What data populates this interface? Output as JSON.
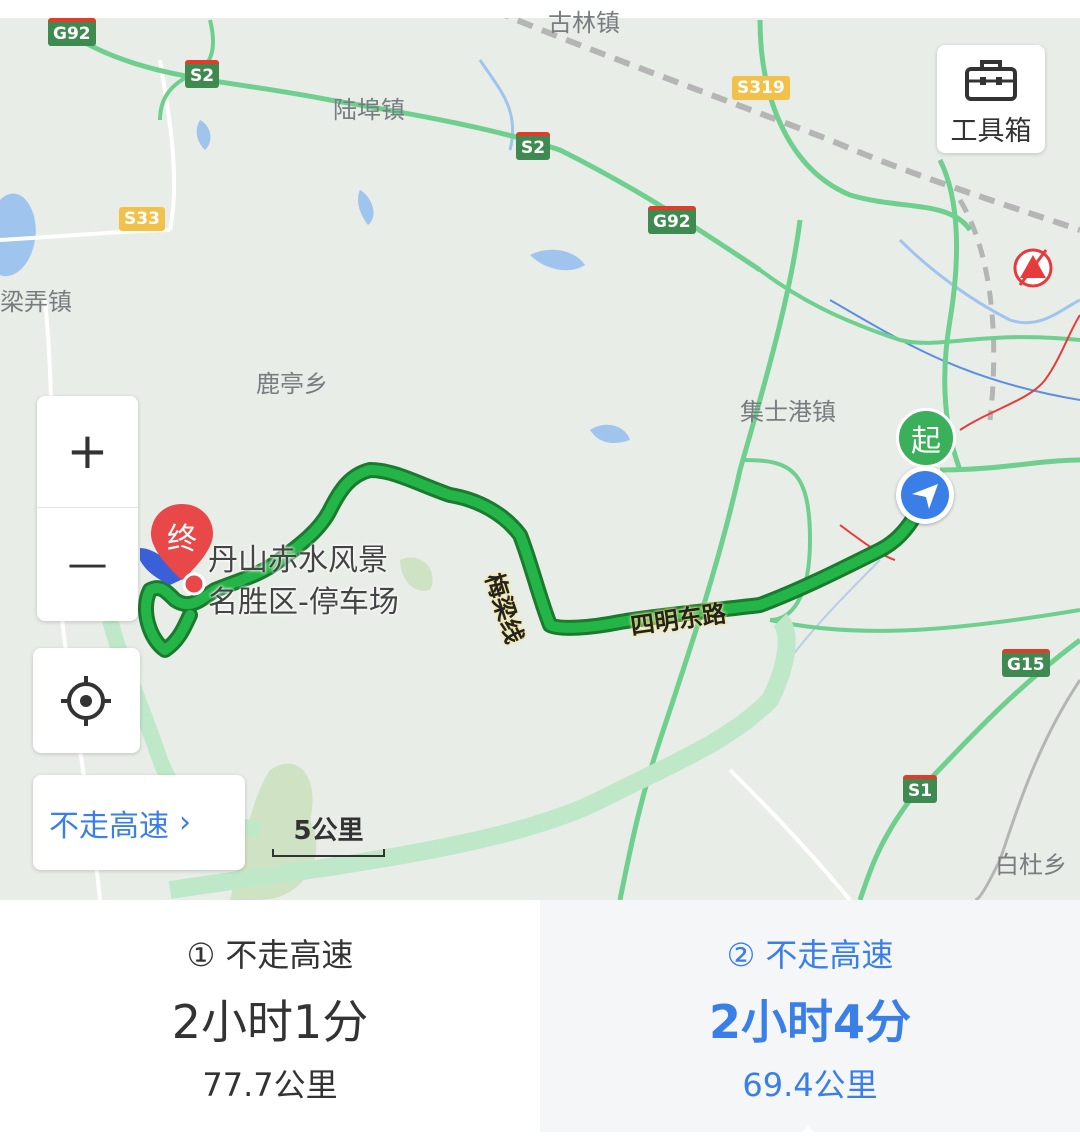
{
  "map": {
    "places": [
      {
        "id": "lubu",
        "text": "陆埠镇"
      },
      {
        "id": "lunong",
        "text": "梁弄镇"
      },
      {
        "id": "luting",
        "text": "鹿亭乡"
      },
      {
        "id": "jishigang",
        "text": "集士港镇"
      },
      {
        "id": "baidu",
        "text": "白杜乡"
      },
      {
        "id": "top",
        "text": "古林镇"
      }
    ],
    "shields": [
      {
        "id": "g92a",
        "text": "G92"
      },
      {
        "id": "s2a",
        "text": "S2"
      },
      {
        "id": "s2b",
        "text": "S2"
      },
      {
        "id": "s319",
        "text": "S319"
      },
      {
        "id": "s33",
        "text": "S33"
      },
      {
        "id": "g92b",
        "text": "G92"
      },
      {
        "id": "g15",
        "text": "G15"
      },
      {
        "id": "s1",
        "text": "S1"
      }
    ],
    "roads": {
      "heliang": "梅梁线",
      "siming": "四明东路"
    },
    "start_marker": "起",
    "end_marker": "终",
    "destination": {
      "line1": "丹山赤水风景",
      "line2": "名胜区-停车场"
    },
    "scale": "5公里"
  },
  "toolbox": {
    "label": "工具箱"
  },
  "zoom": {
    "in": "+",
    "out": "—"
  },
  "avoid_highway": {
    "label": "不走高速"
  },
  "routes": [
    {
      "name": "① 不走高速",
      "time": "2小时1分",
      "distance": "77.7公里",
      "selected": false
    },
    {
      "name": "② 不走高速",
      "time": "2小时4分",
      "distance": "69.4公里",
      "selected": true
    }
  ],
  "colors": {
    "route": "#1fa43a",
    "accent": "#3a7ee8",
    "road": "#6fcf8f"
  }
}
